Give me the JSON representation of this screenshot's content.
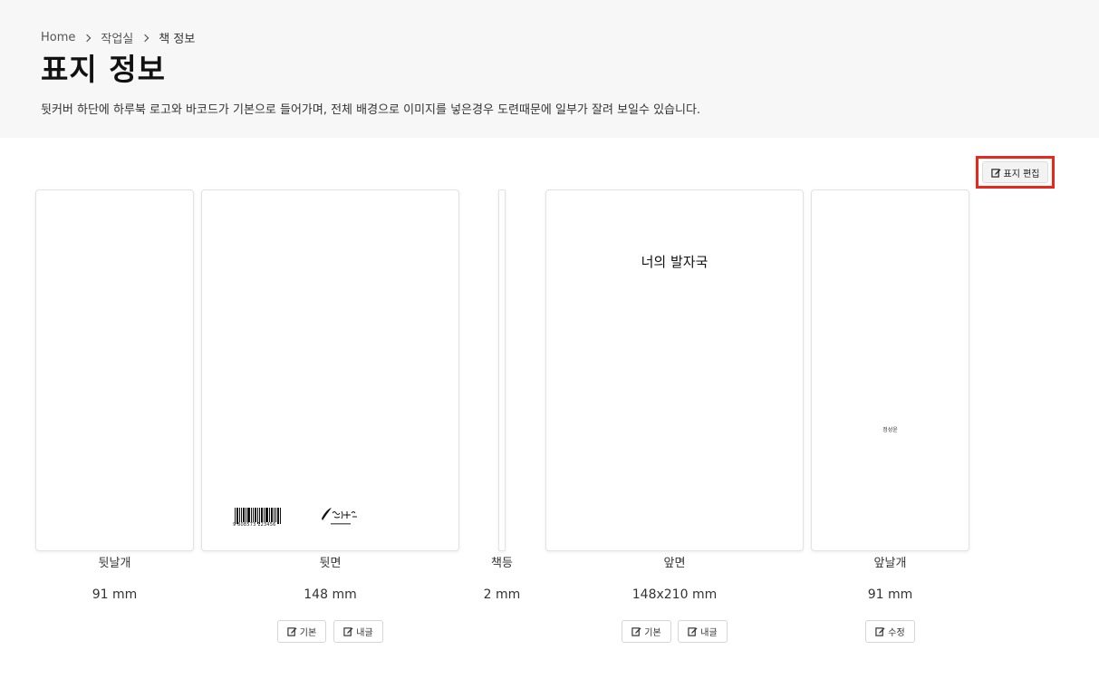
{
  "breadcrumb": {
    "home": "Home",
    "workshop": "작업실",
    "current": "책 정보"
  },
  "page": {
    "title": "표지 정보",
    "description": "뒷커버 하단에 하루북 로고와 바코드가 기본으로 들어가며, 전체 배경으로 이미지를 넣은경우 도련때문에 일부가 잘려 보일수 있습니다."
  },
  "toolbar": {
    "edit_cover_label": "표지 편집"
  },
  "cover": {
    "back_flap": {
      "label": "뒷날개",
      "size": "91 mm"
    },
    "back": {
      "label": "뒷면",
      "size": "148 mm",
      "barcode_number": "9 808573 123456",
      "btn_default": "기본",
      "btn_export": "내글"
    },
    "spine": {
      "label": "책등",
      "size": "2 mm"
    },
    "front": {
      "label": "앞면",
      "size": "148x210 mm",
      "book_title": "너의 발자국",
      "btn_default": "기본",
      "btn_export": "내글"
    },
    "front_flap": {
      "label": "앞날개",
      "size": "91 mm",
      "author": "정성윤",
      "btn_edit": "수정"
    }
  },
  "icons": {
    "edit": "edit-square-icon",
    "chevron": "chevron-right-icon",
    "barcode": "barcode-icon",
    "logo": "haroobook-logo"
  },
  "colors": {
    "highlight": "#e8281b",
    "header_bg": "#f7f7f7"
  }
}
